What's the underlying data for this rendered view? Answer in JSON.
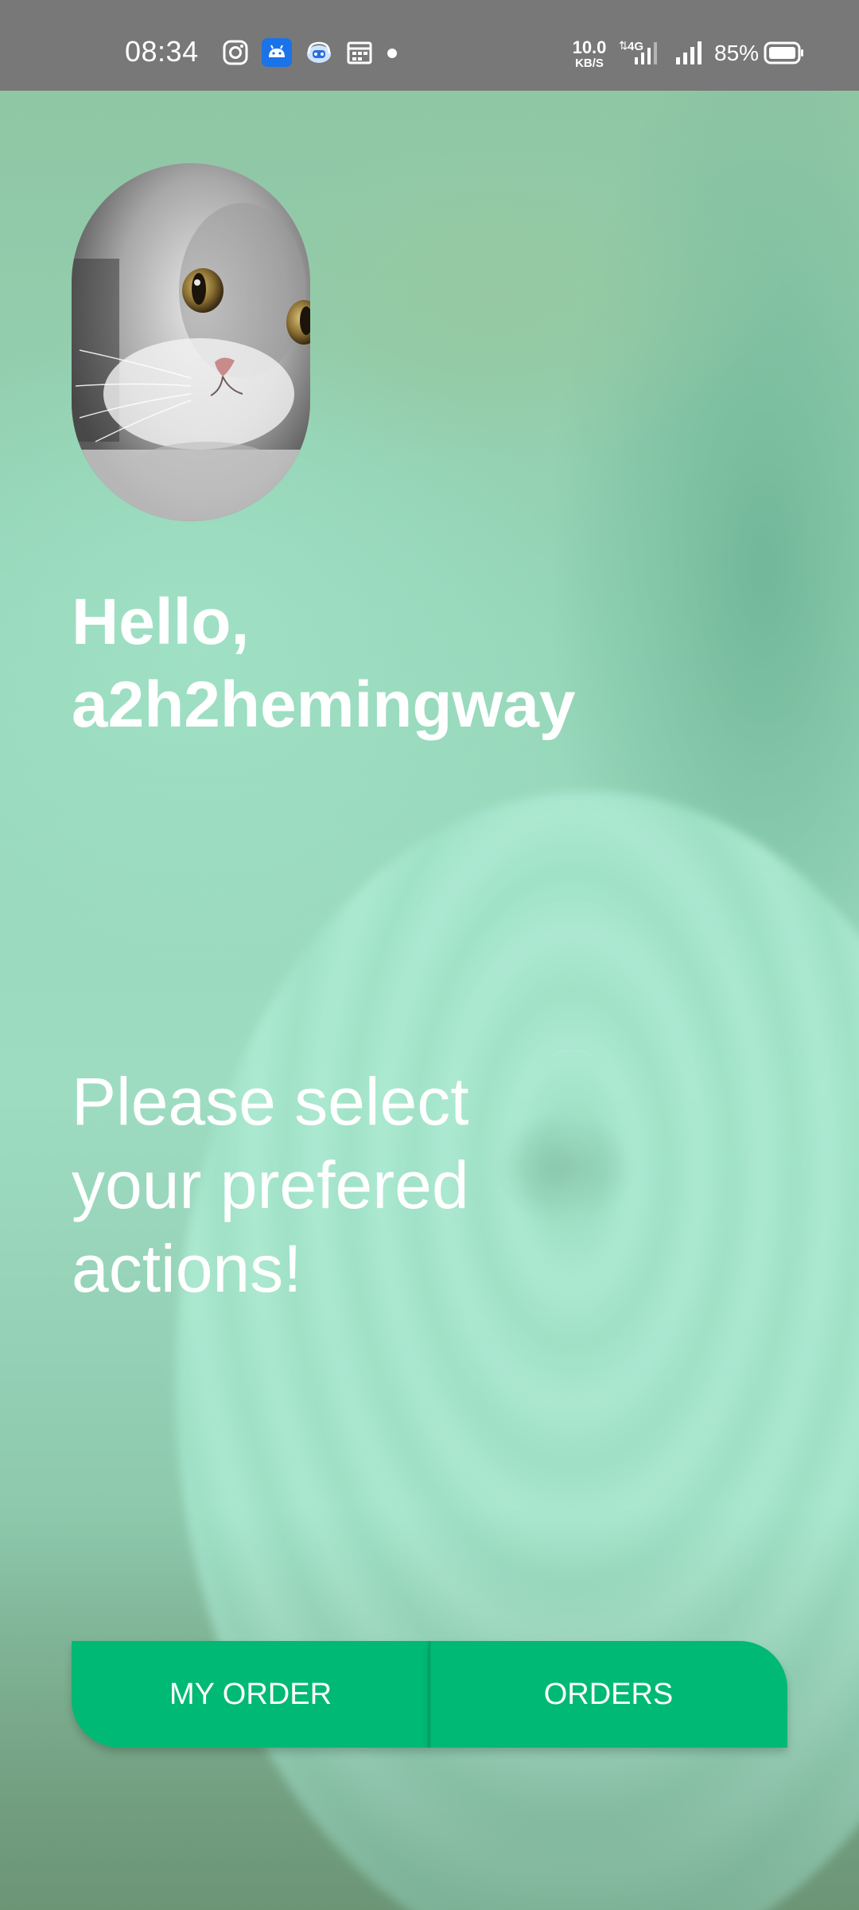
{
  "status_bar": {
    "time": "08:34",
    "net_speed": "10.0",
    "net_unit": "KB/S",
    "battery": "85%",
    "icons": [
      "instagram-icon",
      "android-icon",
      "headset-robot-icon",
      "calendar-icon",
      "notification-dot",
      "data-4g-icon",
      "signal-icon",
      "battery-icon"
    ]
  },
  "profile": {
    "avatar": "cat-photo"
  },
  "greeting": {
    "line1": "Hello,",
    "line2": "a2h2hemingway"
  },
  "prompt": {
    "line1": "Please select",
    "line2": "your prefered",
    "line3": "actions!"
  },
  "actions": {
    "my_order": "MY ORDER",
    "orders": "ORDERS"
  },
  "colors": {
    "accent": "#00b975",
    "status_bar": "#787878",
    "background": "#9edcc2"
  }
}
